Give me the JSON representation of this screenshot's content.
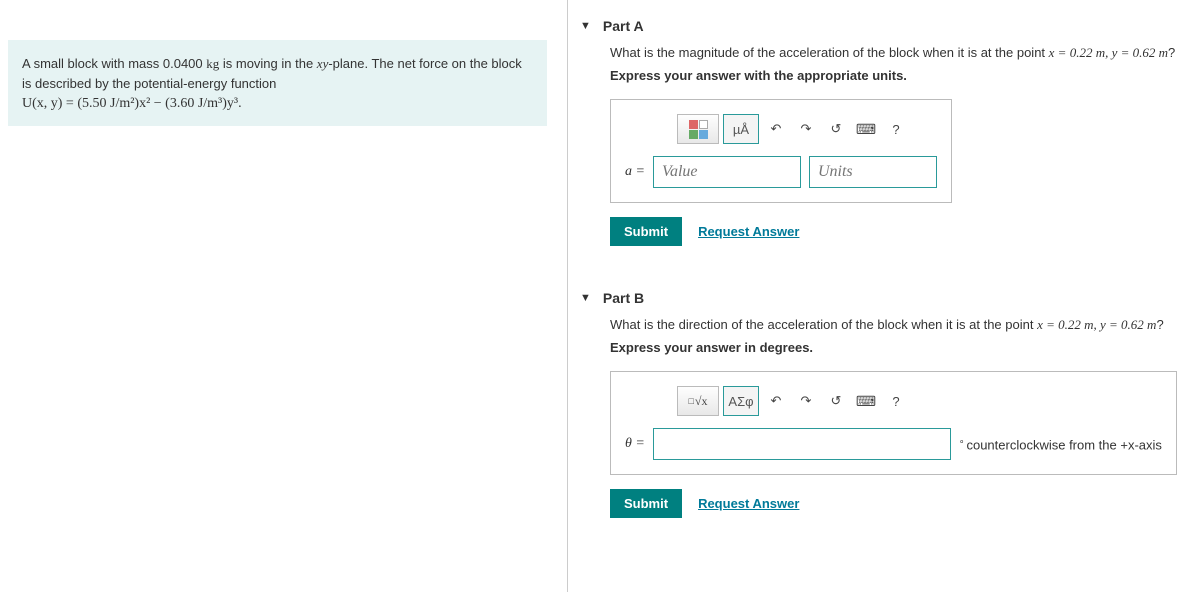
{
  "problem": {
    "line1_pre": "A small block with mass 0.0400 ",
    "line1_kg": "kg",
    "line1_mid": " is moving in the ",
    "line1_xy": "xy",
    "line1_post": "-plane. The net force on the block is described by the potential-energy function",
    "formula": "U(x, y) = (5.50 J/m²)x² − (3.60 J/m³)y³."
  },
  "partA": {
    "title": "Part A",
    "question_pre": "What is the magnitude of the acceleration of the block when it is at the point ",
    "question_vals": "x = 0.22 m, y = 0.62 m",
    "question_post": "?",
    "instruct": "Express your answer with the appropriate units.",
    "var_label": "a =",
    "value_placeholder": "Value",
    "units_placeholder": "Units",
    "submit": "Submit",
    "request": "Request Answer",
    "tool_units": "µÅ"
  },
  "partB": {
    "title": "Part B",
    "question_pre": "What is the direction of the acceleration of the block when it is at the point ",
    "question_vals": "x = 0.22 m, y = 0.62 m",
    "question_post": "?",
    "instruct": "Express your answer in degrees.",
    "var_label": "θ =",
    "suffix": "counterclockwise from the +x-axis",
    "submit": "Submit",
    "request": "Request Answer",
    "tool_greek": "ΑΣφ"
  },
  "icons": {
    "undo": "↶",
    "redo": "↷",
    "reset": "↺",
    "help": "?",
    "sqrt": "√x"
  }
}
